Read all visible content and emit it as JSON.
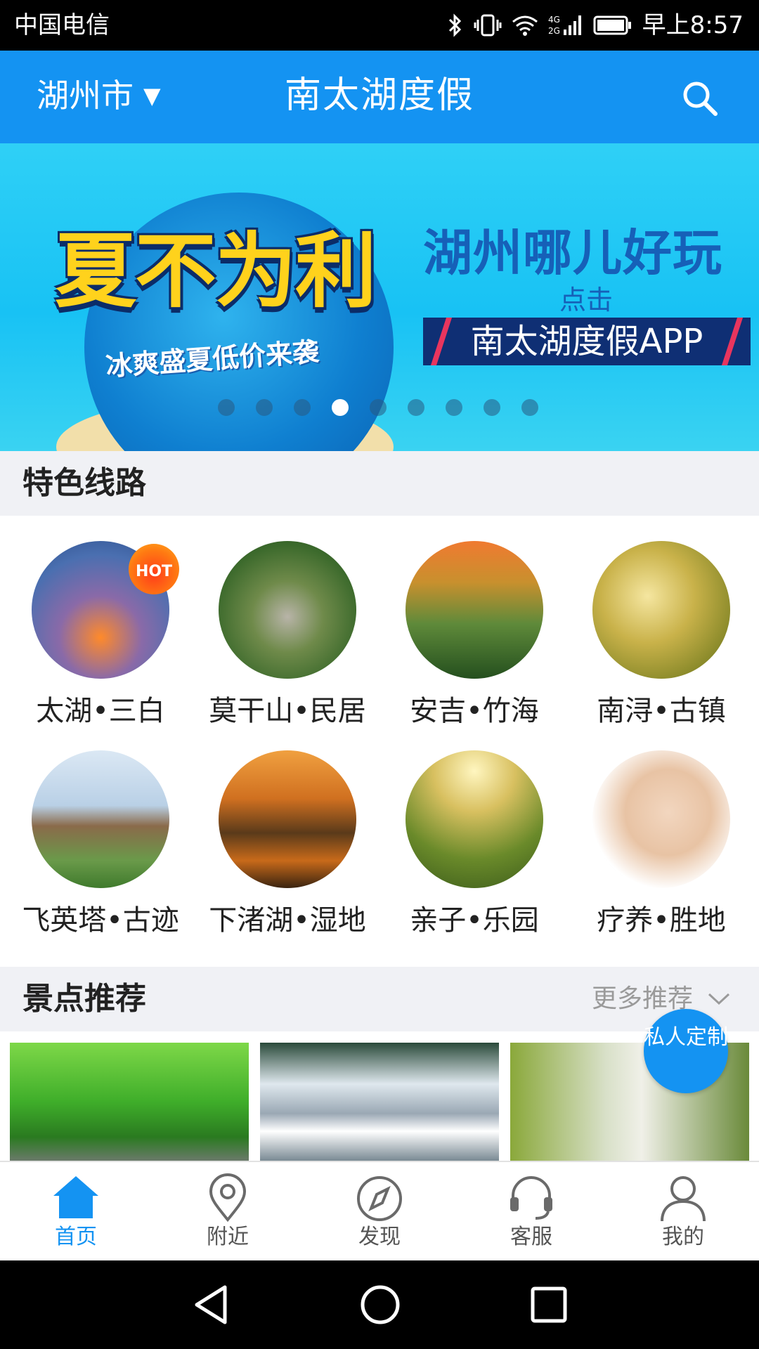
{
  "status_bar": {
    "carrier": "中国电信",
    "time": "早上8:57",
    "network": "4G 2G"
  },
  "header": {
    "city": "湖州市",
    "city_caret": "▼",
    "title": "南太湖度假",
    "search_icon": "search-icon"
  },
  "banner": {
    "slogan": "夏不为利",
    "sub_slogan": "冰爽盛夏低价来袭",
    "headline": "湖州哪儿好玩",
    "click_hint": "点击",
    "app_name": "南太湖度假APP",
    "page_count": 9,
    "active_index": 3
  },
  "featured_routes": {
    "title": "特色线路",
    "hot_badge": "HOT",
    "items": [
      {
        "label": "太湖•三白",
        "hot": true
      },
      {
        "label": "莫干山•民居"
      },
      {
        "label": "安吉•竹海"
      },
      {
        "label": "南浔•古镇"
      },
      {
        "label": "飞英塔•古迹"
      },
      {
        "label": "下渚湖•湿地"
      },
      {
        "label": "亲子•乐园"
      },
      {
        "label": "疗养•胜地"
      }
    ]
  },
  "recommendations": {
    "title": "景点推荐",
    "more_label": "更多推荐",
    "custom_badge": "私人定制"
  },
  "tabbar": {
    "items": [
      {
        "label": "首页",
        "icon": "home-icon",
        "active": true
      },
      {
        "label": "附近",
        "icon": "location-pin-icon"
      },
      {
        "label": "发现",
        "icon": "compass-icon"
      },
      {
        "label": "客服",
        "icon": "headset-icon"
      },
      {
        "label": "我的",
        "icon": "user-icon"
      }
    ]
  },
  "colors": {
    "primary": "#1493f2",
    "section_bg": "#f0f1f5",
    "text": "#222222",
    "muted": "#9a9a9a"
  }
}
